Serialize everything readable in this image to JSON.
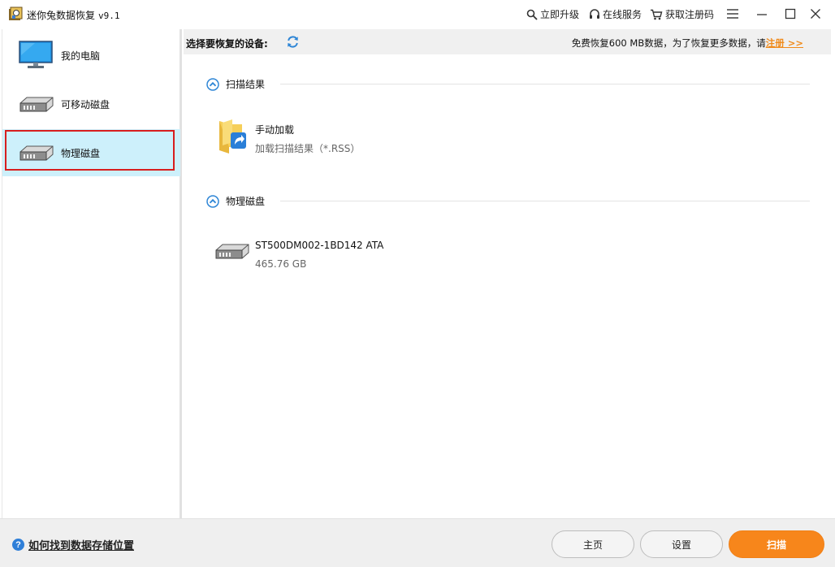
{
  "window": {
    "title": "迷你兔数据恢复",
    "version": "v9.1",
    "links": {
      "upgrade": "立即升级",
      "online_service": "在线服务",
      "get_code": "获取注册码"
    }
  },
  "sidebar": {
    "items": [
      {
        "label": "我的电脑",
        "icon": "monitor-icon"
      },
      {
        "label": "可移动磁盘",
        "icon": "drive-icon"
      },
      {
        "label": "物理磁盘",
        "icon": "drive-icon",
        "selected": true
      }
    ]
  },
  "header": {
    "title": "选择要恢复的设备:",
    "note": "免费恢复600 MB数据，为了恢复更多数据，请",
    "register": "注册 >>"
  },
  "sections": {
    "scan_results": {
      "title": "扫描结果",
      "item": {
        "title": "手动加载",
        "subtitle": "加载扫描结果（*.RSS）"
      }
    },
    "physical_disks": {
      "title": "物理磁盘",
      "item": {
        "title": "ST500DM002-1BD142 ATA",
        "subtitle": "465.76 GB"
      }
    }
  },
  "footer": {
    "help": "如何找到数据存储位置",
    "home": "主页",
    "settings": "设置",
    "scan": "扫描"
  },
  "colors": {
    "accent": "#f7861b",
    "selected_bg": "#cdf0fb",
    "selected_border": "#d81e1e",
    "link_blue": "#2f7fd8"
  }
}
